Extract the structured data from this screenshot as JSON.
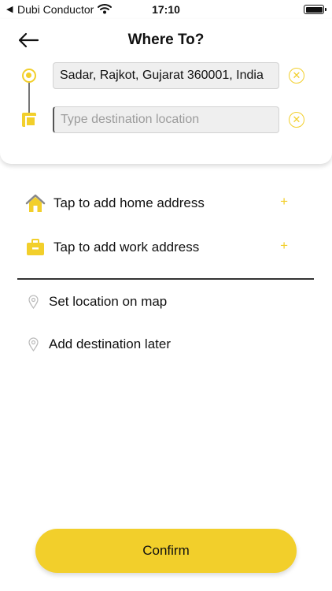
{
  "status_bar": {
    "back_glyph": "◀",
    "carrier": "Dubi Conductor",
    "time": "17:10",
    "icons": [
      "wifi-icon",
      "battery-icon"
    ]
  },
  "header": {
    "title": "Where To?",
    "back_icon": "arrow-left-icon"
  },
  "route": {
    "origin_value": "Sadar, Rajkot, Gujarat 360001, India",
    "destination_value": "",
    "destination_placeholder": "Type destination location",
    "clear_glyph": "✕"
  },
  "saved": {
    "home_label": "Tap to add home address",
    "work_label": "Tap to add work address",
    "plus_glyph": "+"
  },
  "options": {
    "map_label": "Set location on map",
    "later_label": "Add destination later"
  },
  "footer": {
    "confirm_label": "Confirm"
  },
  "colors": {
    "accent": "#f2cf2b",
    "text": "#111111",
    "input_bg": "#efefef"
  }
}
